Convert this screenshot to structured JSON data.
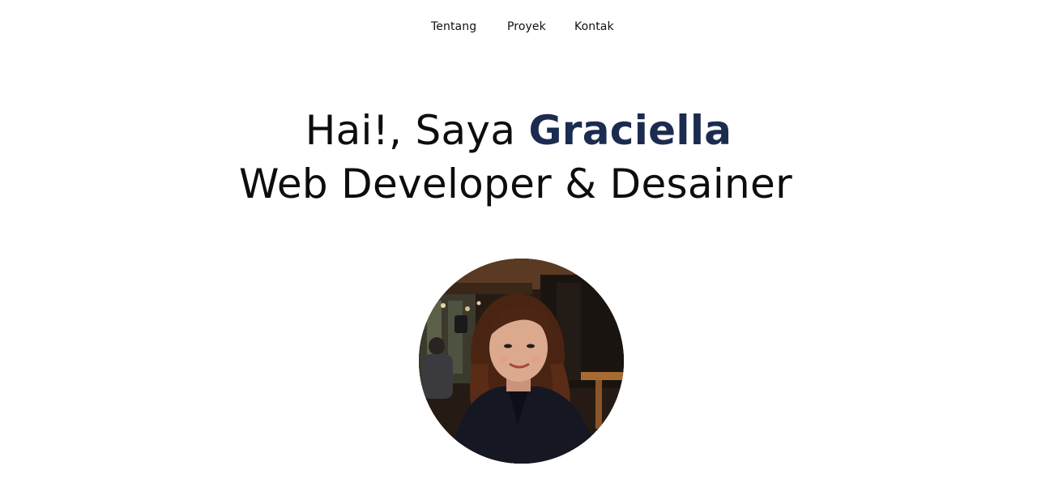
{
  "nav": {
    "items": [
      {
        "label": "Tentang"
      },
      {
        "label": "Proyek"
      },
      {
        "label": "Kontak"
      }
    ]
  },
  "hero": {
    "greeting": "Hai!, Saya ",
    "name": "Graciella",
    "role": "Web Developer & Desainer"
  },
  "colors": {
    "accent": "#1c2b50",
    "text": "#0d0d0d",
    "background": "#ffffff"
  },
  "avatar": {
    "icon": "profile-photo"
  }
}
